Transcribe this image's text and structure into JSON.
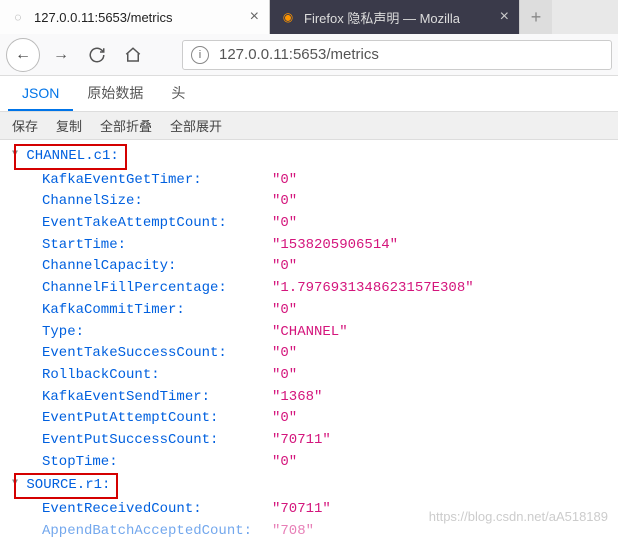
{
  "tabs": [
    {
      "title": "127.0.0.11:5653/metrics",
      "active": true
    },
    {
      "title": "Firefox 隐私声明 — Mozilla",
      "active": false
    }
  ],
  "newtab_label": "+",
  "nav": {
    "back": "←",
    "forward": "→",
    "reload": "↻",
    "home": "⌂"
  },
  "url": "127.0.0.11:5653/metrics",
  "viewer_tabs": {
    "json": "JSON",
    "raw": "原始数据",
    "headers": "头"
  },
  "actions": {
    "save": "保存",
    "copy": "复制",
    "collapse_all": "全部折叠",
    "expand_all": "全部展开"
  },
  "sections": [
    {
      "name": "CHANNEL.c1",
      "label": "CHANNEL.c1:",
      "highlighted": true,
      "truncated_last": false,
      "fields": [
        {
          "key": "KafkaEventGetTimer:",
          "value": "\"0\""
        },
        {
          "key": "ChannelSize:",
          "value": "\"0\""
        },
        {
          "key": "EventTakeAttemptCount:",
          "value": "\"0\""
        },
        {
          "key": "StartTime:",
          "value": "\"1538205906514\""
        },
        {
          "key": "ChannelCapacity:",
          "value": "\"0\""
        },
        {
          "key": "ChannelFillPercentage:",
          "value": "\"1.7976931348623157E308\""
        },
        {
          "key": "KafkaCommitTimer:",
          "value": "\"0\""
        },
        {
          "key": "Type:",
          "value": "\"CHANNEL\""
        },
        {
          "key": "EventTakeSuccessCount:",
          "value": "\"0\""
        },
        {
          "key": "RollbackCount:",
          "value": "\"0\""
        },
        {
          "key": "KafkaEventSendTimer:",
          "value": "\"1368\""
        },
        {
          "key": "EventPutAttemptCount:",
          "value": "\"0\""
        },
        {
          "key": "EventPutSuccessCount:",
          "value": "\"70711\""
        },
        {
          "key": "StopTime:",
          "value": "\"0\""
        }
      ]
    },
    {
      "name": "SOURCE.r1",
      "label": "SOURCE.r1:",
      "highlighted": true,
      "truncated_last": true,
      "fields": [
        {
          "key": "EventReceivedCount:",
          "value": "\"70711\""
        },
        {
          "key": "AppendBatchAcceptedCount:",
          "value": "\"708\""
        }
      ]
    }
  ],
  "watermark": "https://blog.csdn.net/aA518189"
}
